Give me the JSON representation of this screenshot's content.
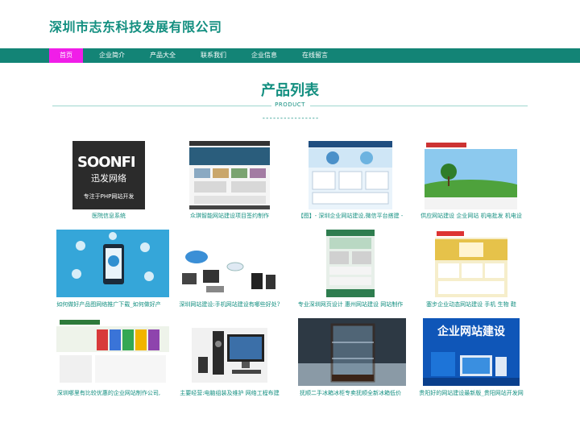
{
  "header": {
    "title": "深圳市志东科技发展有限公司"
  },
  "nav": {
    "items": [
      {
        "label": "首页",
        "active": true
      },
      {
        "label": "企业简介",
        "active": false
      },
      {
        "label": "产品大全",
        "active": false
      },
      {
        "label": "联系我们",
        "active": false
      },
      {
        "label": "企业信息",
        "active": false
      },
      {
        "label": "在线留言",
        "active": false
      }
    ]
  },
  "section": {
    "title": "产品列表",
    "subtitle": "PRODUCT",
    "divider": "----------------"
  },
  "products": [
    {
      "caption": "医院信息系统",
      "thumb": {
        "logo": "SOONFI",
        "logo_cn": "迅发网络",
        "logo_sub": "专注于PHP网站开发"
      }
    },
    {
      "caption": "众琪智能网站建设项目签约制作"
    },
    {
      "caption": "【图】- 深圳企业网站建设,微信平台搭建 -"
    },
    {
      "caption": "供应网站建设 企业网站 机电批发 机电设"
    },
    {
      "caption": "如何做好产品图网络推广下载_如何做好产"
    },
    {
      "caption": "深圳网站建设:手机网站建设有哪些好处?"
    },
    {
      "caption": "专业深圳网页设计 惠州网站建设 网站制作"
    },
    {
      "caption": "塞步企业动态网站建设 手机 生物 鞋"
    },
    {
      "caption": "深圳哪里有比较优惠的企业网站制作公司,"
    },
    {
      "caption": "主要经营:电脑组装及维护 网络工程布建"
    },
    {
      "caption": "抚顺二手冰箱冰柜专卖抚顺全新冰箱低价"
    },
    {
      "caption": "贵阳好的网站建设最新版_贵阳网站开发网",
      "thumb": {
        "big": "企业网站建设"
      }
    }
  ]
}
